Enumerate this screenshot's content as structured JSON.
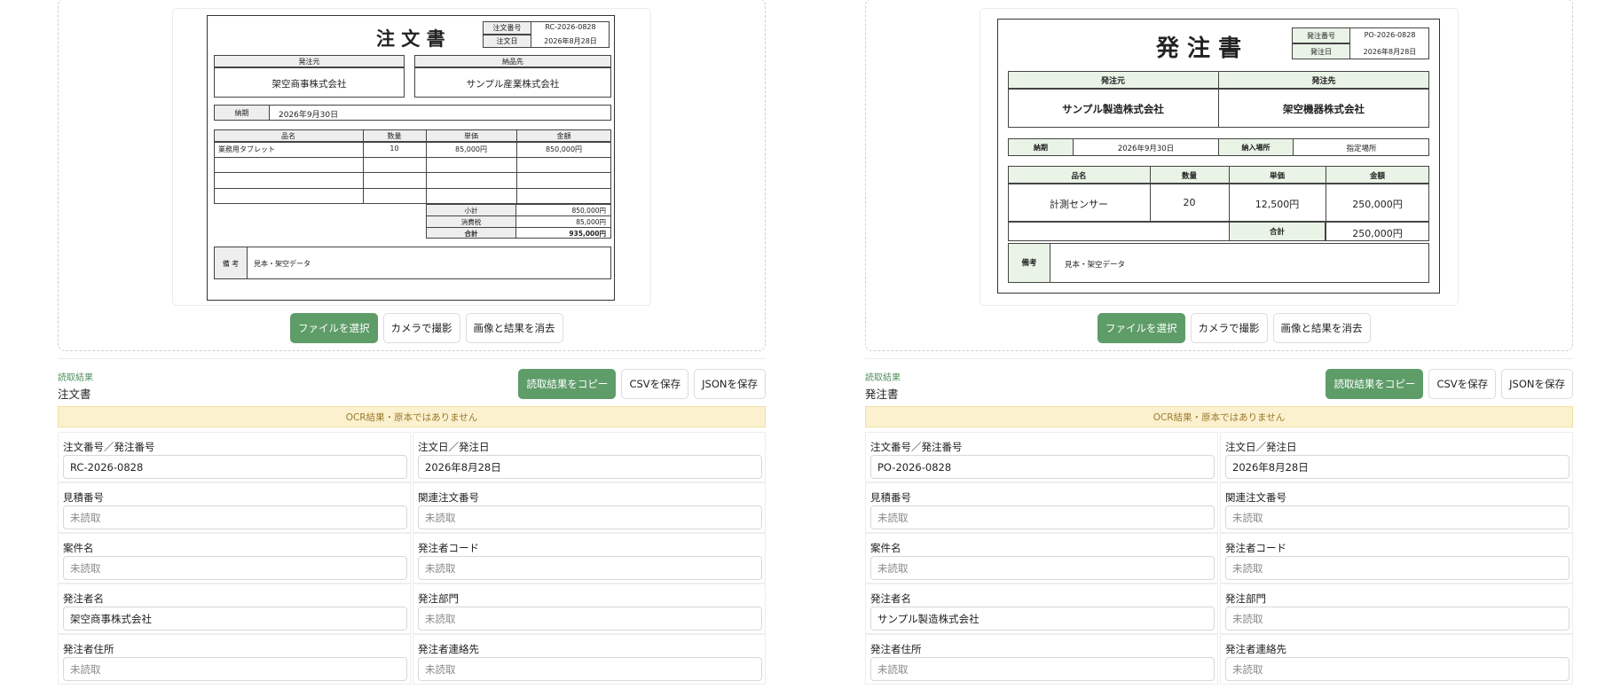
{
  "panels": [
    {
      "doc": {
        "title": "注 文 書",
        "meta": [
          {
            "label": "注文番号",
            "value": "RC-2026-0828"
          },
          {
            "label": "注文日",
            "value": "2026年8月28日"
          }
        ],
        "from_label": "発注元",
        "from_value": "架空商事株式会社",
        "to_label": "納品先",
        "to_value": "サンプル産業株式会社",
        "deadline_label": "納期",
        "deadline_value": "2026年9月30日",
        "headers": [
          "品名",
          "数量",
          "単価",
          "金額"
        ],
        "items": [
          {
            "name": "業務用タブレット",
            "qty": "10",
            "price": "85,000円",
            "amount": "850,000円"
          }
        ],
        "subtotal_label": "小計",
        "subtotal_value": "850,000円",
        "tax_label": "消費税",
        "tax_value": "85,000円",
        "total_label": "合計",
        "total_value": "935,000円",
        "remarks_label": "備 考",
        "remarks_value": "見本・架空データ"
      },
      "buttons": {
        "select": "ファイルを選択",
        "camera": "カメラで撮影",
        "clear": "画像と結果を消去"
      },
      "result": {
        "kicker": "読取結果",
        "title": "注文書",
        "copy": "読取結果をコピー",
        "csv": "CSVを保存",
        "json": "JSONを保存",
        "warning": "OCR結果・原本ではありません"
      },
      "fields": [
        {
          "label": "注文番号／発注番号",
          "value": "RC-2026-0828"
        },
        {
          "label": "注文日／発注日",
          "value": "2026年8月28日"
        },
        {
          "label": "見積番号",
          "value": ""
        },
        {
          "label": "関連注文番号",
          "value": ""
        },
        {
          "label": "案件名",
          "value": ""
        },
        {
          "label": "発注者コード",
          "value": ""
        },
        {
          "label": "発注者名",
          "value": "架空商事株式会社"
        },
        {
          "label": "発注部門",
          "value": ""
        },
        {
          "label": "発注者住所",
          "value": ""
        },
        {
          "label": "発注者連絡先",
          "value": ""
        }
      ],
      "placeholder": "未読取"
    },
    {
      "doc": {
        "title": "発 注 書",
        "meta": [
          {
            "label": "発注番号",
            "value": "PO-2026-0828"
          },
          {
            "label": "発注日",
            "value": "2026年8月28日"
          }
        ],
        "from_label": "発注元",
        "from_value": "サンプル製造株式会社",
        "to_label": "発注先",
        "to_value": "架空機器株式会社",
        "deadline_label": "納期",
        "deadline_value": "2026年9月30日",
        "place_label": "納入場所",
        "place_value": "指定場所",
        "headers": [
          "品名",
          "数量",
          "単価",
          "金額"
        ],
        "items": [
          {
            "name": "計測センサー",
            "qty": "20",
            "price": "12,500円",
            "amount": "250,000円"
          }
        ],
        "total_label": "合計",
        "total_value": "250,000円",
        "remarks_label": "備考",
        "remarks_value": "見本・架空データ"
      },
      "buttons": {
        "select": "ファイルを選択",
        "camera": "カメラで撮影",
        "clear": "画像と結果を消去"
      },
      "result": {
        "kicker": "読取結果",
        "title": "発注書",
        "copy": "読取結果をコピー",
        "csv": "CSVを保存",
        "json": "JSONを保存",
        "warning": "OCR結果・原本ではありません"
      },
      "fields": [
        {
          "label": "注文番号／発注番号",
          "value": "PO-2026-0828"
        },
        {
          "label": "注文日／発注日",
          "value": "2026年8月28日"
        },
        {
          "label": "見積番号",
          "value": ""
        },
        {
          "label": "関連注文番号",
          "value": ""
        },
        {
          "label": "案件名",
          "value": ""
        },
        {
          "label": "発注者コード",
          "value": ""
        },
        {
          "label": "発注者名",
          "value": "サンプル製造株式会社"
        },
        {
          "label": "発注部門",
          "value": ""
        },
        {
          "label": "発注者住所",
          "value": ""
        },
        {
          "label": "発注者連絡先",
          "value": ""
        }
      ],
      "placeholder": "未読取"
    }
  ],
  "colors": {
    "primary": "#5e9c68",
    "warning_bg": "#fcf1cf",
    "warning_text": "#9a7a2a",
    "accent_text": "#4f8f5c"
  }
}
